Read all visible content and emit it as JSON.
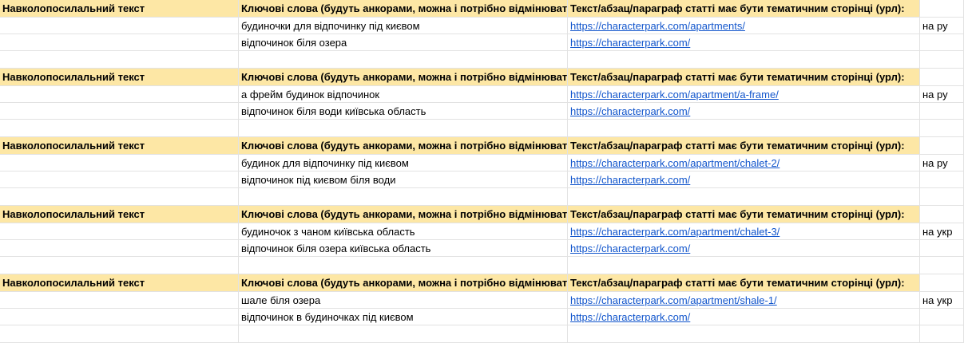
{
  "blocks": [
    {
      "header": {
        "col_a": "Навколопосилальний текст",
        "col_b": "Ключові слова (будуть анкорами, можна і потрібно відмінювати)",
        "col_c": "Текст/абзац/параграф статті має бути тематичним сторінці (урл):"
      },
      "rows": [
        {
          "keyword": "будиночки для відпочинку під києвом",
          "url": "https://characterpark.com/apartments/",
          "lang": "на ру"
        },
        {
          "keyword": "відпочинок біля озера",
          "url": "https://characterpark.com/",
          "lang": ""
        }
      ]
    },
    {
      "header": {
        "col_a": "Навколопосилальний текст",
        "col_b": "Ключові слова (будуть анкорами, можна і потрібно відмінювати)",
        "col_c": "Текст/абзац/параграф статті має бути тематичним сторінці (урл):"
      },
      "rows": [
        {
          "keyword": "а фрейм будинок відпочинок",
          "url": "https://characterpark.com/apartment/a-frame/",
          "lang": "на ру"
        },
        {
          "keyword": "відпочинок біля води київська область",
          "url": "https://characterpark.com/",
          "lang": ""
        }
      ]
    },
    {
      "header": {
        "col_a": "Навколопосилальний текст",
        "col_b": "Ключові слова (будуть анкорами, можна і потрібно відмінювати)",
        "col_c": "Текст/абзац/параграф статті має бути тематичним сторінці (урл):"
      },
      "rows": [
        {
          "keyword": "будинок для відпочинку під києвом",
          "url": "https://characterpark.com/apartment/chalet-2/",
          "lang": "на ру"
        },
        {
          "keyword": "відпочинок під києвом біля води",
          "url": "https://characterpark.com/",
          "lang": ""
        }
      ]
    },
    {
      "header": {
        "col_a": "Навколопосилальний текст",
        "col_b": "Ключові слова (будуть анкорами, можна і потрібно відмінювати)",
        "col_c": "Текст/абзац/параграф статті має бути тематичним сторінці (урл):"
      },
      "rows": [
        {
          "keyword": "будиночок з чаном київська область",
          "url": "https://characterpark.com/apartment/chalet-3/",
          "lang": "на укр"
        },
        {
          "keyword": "відпочинок біля озера київська область",
          "url": "https://characterpark.com/",
          "lang": ""
        }
      ]
    },
    {
      "header": {
        "col_a": "Навколопосилальний текст",
        "col_b": "Ключові слова (будуть анкорами, можна і потрібно відмінювати)",
        "col_c": "Текст/абзац/параграф статті має бути тематичним сторінці (урл):"
      },
      "rows": [
        {
          "keyword": "шале біля озера",
          "url": "https://characterpark.com/apartment/shale-1/",
          "lang": "на укр"
        },
        {
          "keyword": "відпочинок в будиночках під києвом",
          "url": "https://characterpark.com/",
          "lang": ""
        }
      ]
    }
  ]
}
